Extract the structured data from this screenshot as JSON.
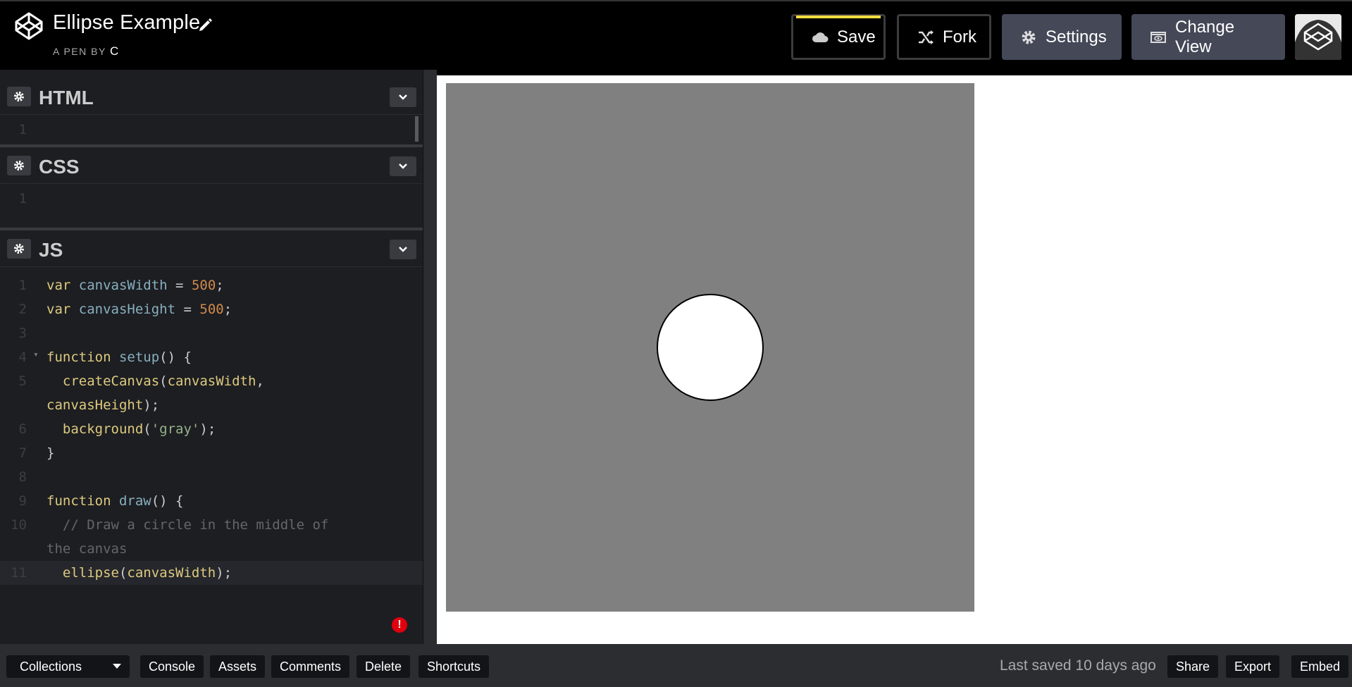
{
  "header": {
    "title": "Ellipse Example",
    "byline_prefix": "A PEN BY",
    "byline_user": "C",
    "buttons": {
      "save": "Save",
      "fork": "Fork",
      "settings": "Settings",
      "change_view": "Change View"
    }
  },
  "editors": {
    "html": {
      "name": "HTML",
      "lines": [
        "1"
      ]
    },
    "css": {
      "name": "CSS",
      "lines": [
        "1"
      ]
    },
    "js": {
      "name": "JS",
      "code": [
        {
          "n": "1",
          "parts": [
            [
              "kw",
              "var "
            ],
            [
              "vn",
              "canvasWidth"
            ],
            [
              "pu",
              " = "
            ],
            [
              "num",
              "500"
            ],
            [
              "pu",
              ";"
            ]
          ]
        },
        {
          "n": "2",
          "parts": [
            [
              "kw",
              "var "
            ],
            [
              "vn",
              "canvasHeight"
            ],
            [
              "pu",
              " = "
            ],
            [
              "num",
              "500"
            ],
            [
              "pu",
              ";"
            ]
          ]
        },
        {
          "n": "3",
          "parts": []
        },
        {
          "n": "4",
          "fold": true,
          "parts": [
            [
              "kw",
              "function "
            ],
            [
              "vn",
              "setup"
            ],
            [
              "pu",
              "() {"
            ]
          ]
        },
        {
          "n": "5",
          "parts": [
            [
              "fn",
              "  createCanvas"
            ],
            [
              "pu",
              "("
            ],
            [
              "fn",
              "canvasWidth"
            ],
            [
              "pu",
              ","
            ]
          ]
        },
        {
          "n": "",
          "parts": [
            [
              "fn",
              "canvasHeight"
            ],
            [
              "pu",
              ");"
            ]
          ]
        },
        {
          "n": "6",
          "parts": [
            [
              "fn",
              "  background"
            ],
            [
              "pu",
              "("
            ],
            [
              "str",
              "'gray'"
            ],
            [
              "pu",
              ");"
            ]
          ]
        },
        {
          "n": "7",
          "parts": [
            [
              "pu",
              "}"
            ]
          ]
        },
        {
          "n": "8",
          "parts": []
        },
        {
          "n": "9",
          "parts": [
            [
              "kw",
              "function "
            ],
            [
              "vn",
              "draw"
            ],
            [
              "pu",
              "() {"
            ]
          ]
        },
        {
          "n": "10",
          "parts": [
            [
              "cm",
              "  // Draw a circle in the middle of"
            ]
          ]
        },
        {
          "n": "",
          "parts": [
            [
              "cm",
              "the canvas"
            ]
          ]
        },
        {
          "n": "11",
          "active": true,
          "parts": [
            [
              "fn",
              "  ellipse"
            ],
            [
              "pu",
              "("
            ],
            [
              "fn",
              "canvasWidth"
            ],
            [
              "pu",
              ");"
            ]
          ]
        }
      ]
    },
    "error_indicator": "!"
  },
  "footer": {
    "collections": "Collections",
    "console": "Console",
    "assets": "Assets",
    "comments": "Comments",
    "delete": "Delete",
    "shortcuts": "Shortcuts",
    "last_saved": "Last saved 10 days ago",
    "share": "Share",
    "export": "Export",
    "embed": "Embed"
  },
  "colors": {
    "save_accent": "#ffdd40",
    "editor_bg": "#1d1e22",
    "canvas_bg": "#808080",
    "error": "#e0000e"
  }
}
